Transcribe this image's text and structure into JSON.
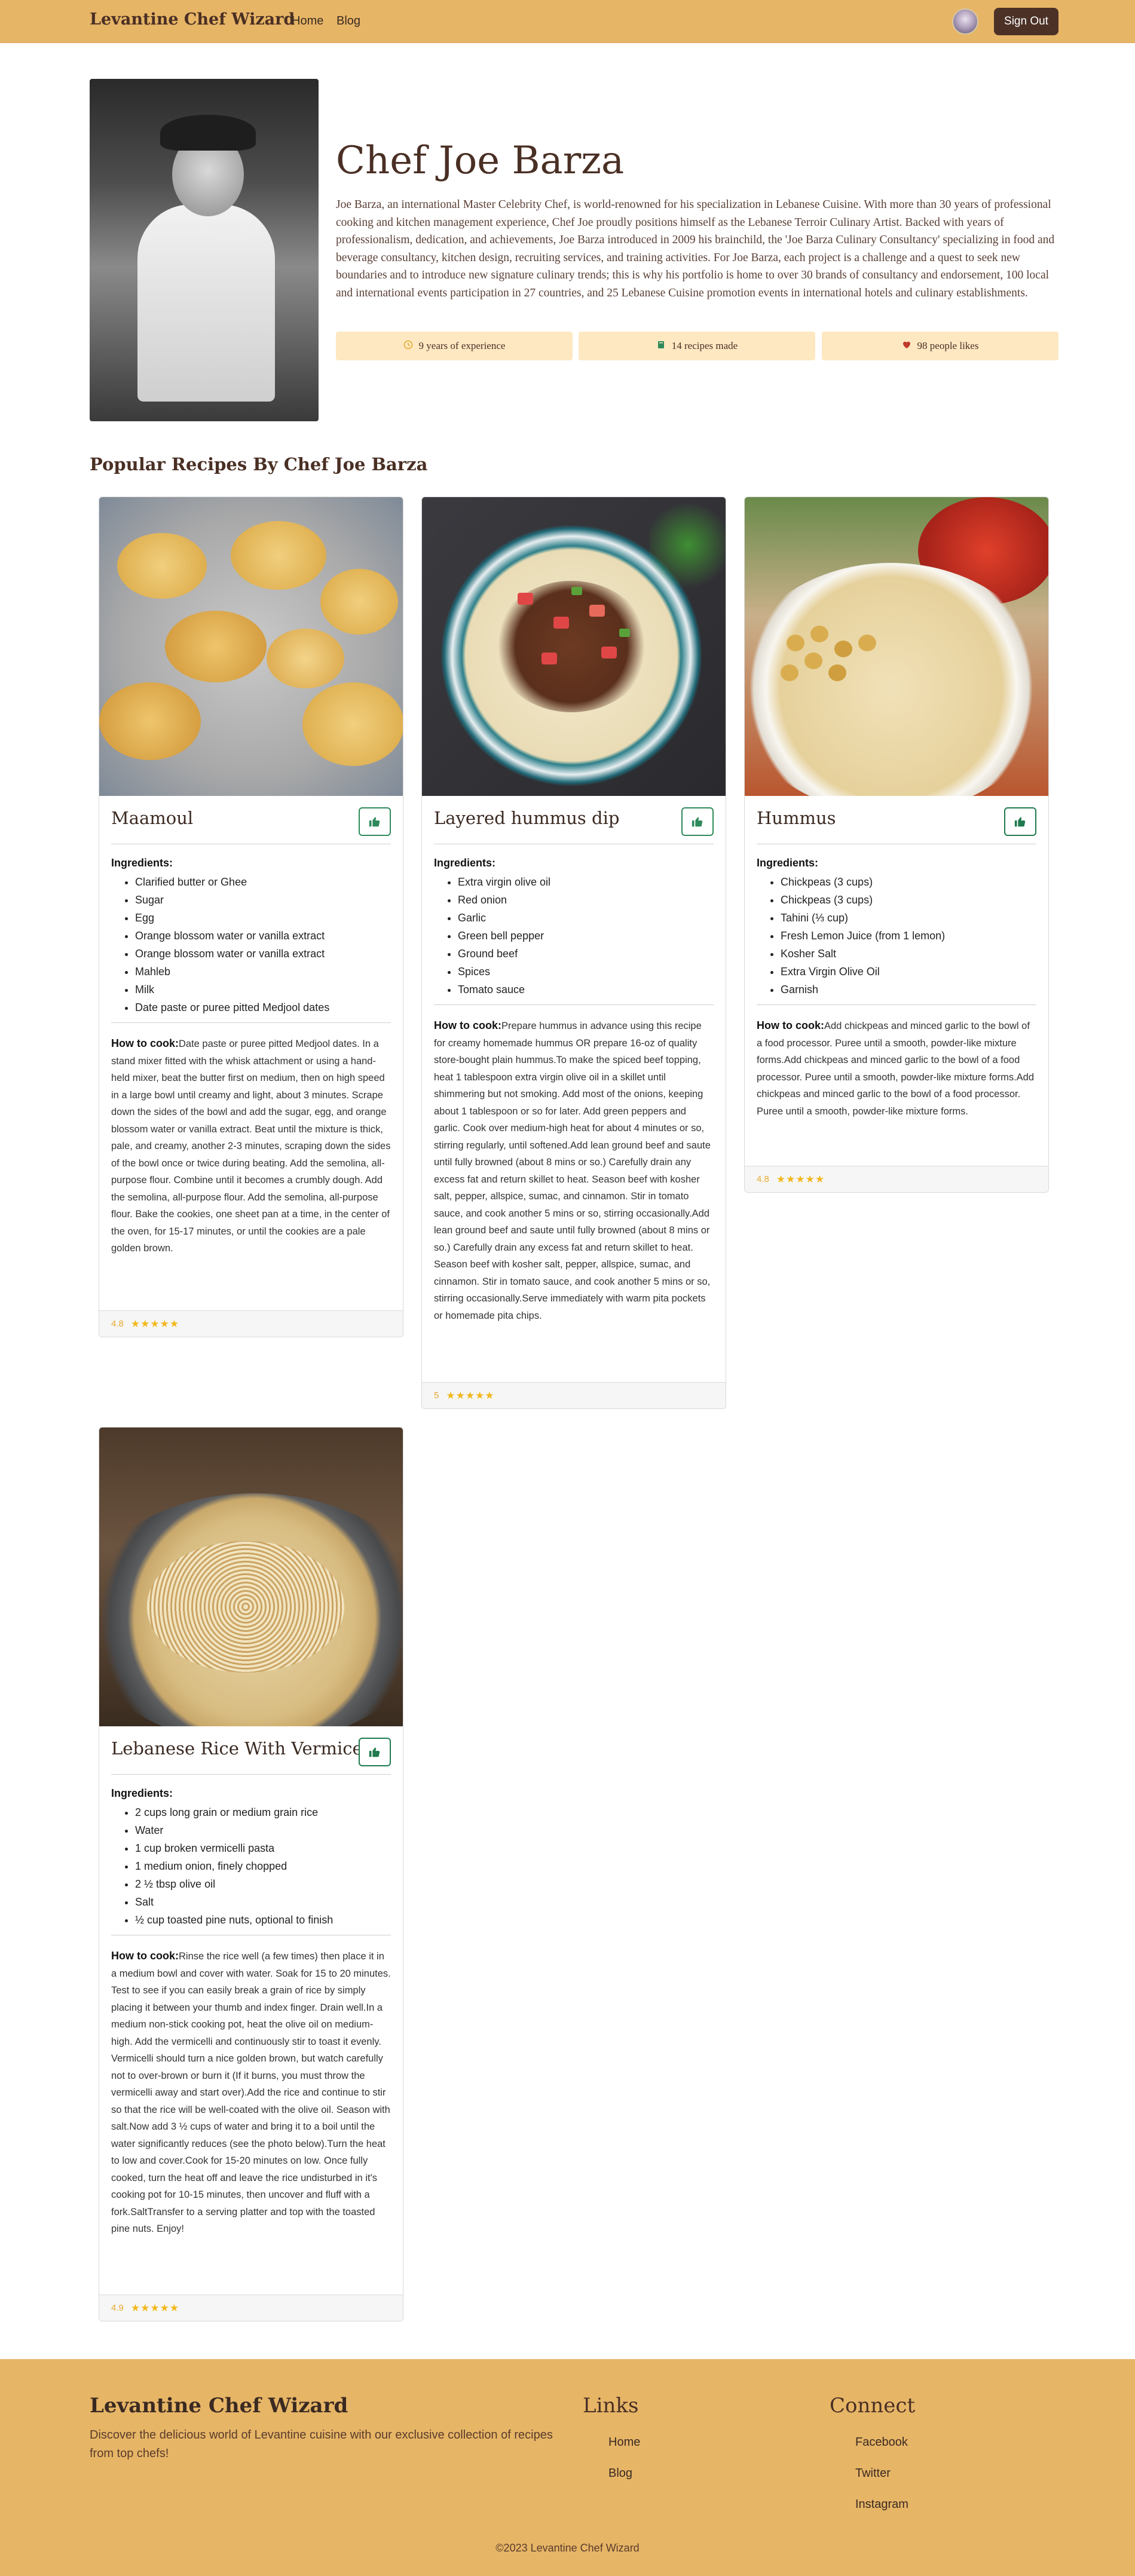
{
  "nav": {
    "brand": "Levantine Chef Wizard",
    "links": [
      "Home",
      "Blog"
    ],
    "signout_label": "Sign Out"
  },
  "chef": {
    "name": "Chef Joe Barza",
    "bio": "Joe Barza, an international Master Celebrity Chef, is world-renowned for his specialization in Lebanese Cuisine. With more than 30 years of professional cooking and kitchen management experience, Chef Joe proudly positions himself as the Lebanese Terroir Culinary Artist. Backed with years of professionalism, dedication, and achievements, Joe Barza introduced in 2009 his brainchild, the 'Joe Barza Culinary Consultancy' specializing in food and beverage consultancy, kitchen design, recruiting services, and training activities. For Joe Barza, each project is a challenge and a quest to seek new boundaries and to introduce new signature culinary trends; this is why his portfolio is home to over 30 brands of consultancy and endorsement, 100 local and international events participation in 27 countries, and 25 Lebanese Cuisine promotion events in international hotels and culinary establishments.",
    "stats": [
      {
        "icon": "clock-icon",
        "text": "9 years of experience"
      },
      {
        "icon": "book-icon",
        "text": "14 recipes made"
      },
      {
        "icon": "heart-icon",
        "text": "98 people likes"
      }
    ]
  },
  "section": {
    "title": "Popular Recipes By Chef Joe Barza"
  },
  "labels": {
    "ingredients": "Ingredients:",
    "how_to_cook": "How to cook:",
    "stars": "★★★★★"
  },
  "recipes": [
    {
      "title": "Maamoul",
      "ingredients": [
        "Clarified butter or Ghee",
        "Sugar",
        "Egg",
        "Orange blossom water or vanilla extract",
        "Orange blossom water or vanilla extract",
        "Mahleb",
        "Milk",
        "Date paste or puree pitted Medjool dates"
      ],
      "how": "Date paste or puree pitted Medjool dates. In a stand mixer fitted with the whisk attachment or using a hand-held mixer, beat the butter first on medium, then on high speed in a large bowl until creamy and light, about 3 minutes. Scrape down the sides of the bowl and add the sugar, egg, and orange blossom water or vanilla extract. Beat until the mixture is thick, pale, and creamy, another 2-3 minutes, scraping down the sides of the bowl once or twice during beating. Add the semolina, all-purpose flour. Combine until it becomes a crumbly dough. Add the semolina, all-purpose flour. Add the semolina, all-purpose flour. Bake the cookies, one sheet pan at a time, in the center of the oven, for 15-17 minutes, or until the cookies are a pale golden brown.",
      "rating": "4.8"
    },
    {
      "title": "Layered hummus dip",
      "ingredients": [
        "Extra virgin olive oil",
        "Red onion",
        "Garlic",
        "Green bell pepper",
        "Ground beef",
        "Spices",
        "Tomato sauce"
      ],
      "how": "Prepare hummus in advance using this recipe for creamy homemade hummus OR prepare 16-oz of quality store-bought plain hummus.To make the spiced beef topping, heat 1 tablespoon extra virgin olive oil in a skillet until shimmering but not smoking. Add most of the onions, keeping about 1 tablespoon or so for later. Add green peppers and garlic. Cook over medium-high heat for about 4 minutes or so, stirring regularly, until softened.Add lean ground beef and saute until fully browned (about 8 mins or so.) Carefully drain any excess fat and return skillet to heat. Season beef with kosher salt, pepper, allspice, sumac, and cinnamon. Stir in tomato sauce, and cook another 5 mins or so, stirring occasionally.Add lean ground beef and saute until fully browned (about 8 mins or so.) Carefully drain any excess fat and return skillet to heat. Season beef with kosher salt, pepper, allspice, sumac, and cinnamon. Stir in tomato sauce, and cook another 5 mins or so, stirring occasionally.Serve immediately with warm pita pockets or homemade pita chips.",
      "rating": "5"
    },
    {
      "title": "Hummus",
      "ingredients": [
        "Chickpeas (3 cups)",
        "Chickpeas (3 cups)",
        "Tahini (⅓ cup)",
        "Fresh Lemon Juice (from 1 lemon)",
        "Kosher Salt",
        "Extra Virgin Olive Oil",
        "Garnish"
      ],
      "how": "Add chickpeas and minced garlic to the bowl of a food processor. Puree until a smooth, powder-like mixture forms.Add chickpeas and minced garlic to the bowl of a food processor. Puree until a smooth, powder-like mixture forms.Add chickpeas and minced garlic to the bowl of a food processor. Puree until a smooth, powder-like mixture forms.",
      "rating": "4.8"
    },
    {
      "title": "Lebanese Rice With Vermicelli",
      "ingredients": [
        "2 cups long grain or medium grain rice",
        "Water",
        "1 cup broken vermicelli pasta",
        "1 medium onion, finely chopped",
        "2 ½ tbsp olive oil",
        "Salt",
        "½ cup toasted pine nuts, optional to finish"
      ],
      "how": "Rinse the rice well (a few times) then place it in a medium bowl and cover with water. Soak for 15 to 20 minutes. Test to see if you can easily break a grain of rice by simply placing it between your thumb and index finger. Drain well.In a medium non-stick cooking pot, heat the olive oil on medium-high. Add the vermicelli and continuously stir to toast it evenly. Vermicelli should turn a nice golden brown, but watch carefully not to over-brown or burn it (If it burns, you must throw the vermicelli away and start over).Add the rice and continue to stir so that the rice will be well-coated with the olive oil. Season with salt.Now add 3 ½ cups of water and bring it to a boil until the water significantly reduces (see the photo below).Turn the heat to low and cover.Cook for 15-20 minutes on low. Once fully cooked, turn the heat off and leave the rice undisturbed in it's cooking pot for 10-15 minutes, then uncover and fluff with a fork.SaltTransfer to a serving platter and top with the toasted pine nuts. Enjoy!",
      "rating": "4.9"
    }
  ],
  "footer": {
    "brand": "Levantine Chef Wizard",
    "description": "Discover the delicious world of Levantine cuisine with our exclusive collection of recipes from top chefs!",
    "links_heading": "Links",
    "links": [
      "Home",
      "Blog"
    ],
    "connect_heading": "Connect",
    "connect": [
      "Facebook",
      "Twitter",
      "Instagram"
    ],
    "copyright": "©2023 Levantine Chef Wizard"
  },
  "colors": {
    "nav_bg": "#e6b566",
    "accent_dark": "#4c3127",
    "stat_bg": "#fde8c2",
    "like_green": "#2f8a5b",
    "star": "#f2b71b"
  }
}
